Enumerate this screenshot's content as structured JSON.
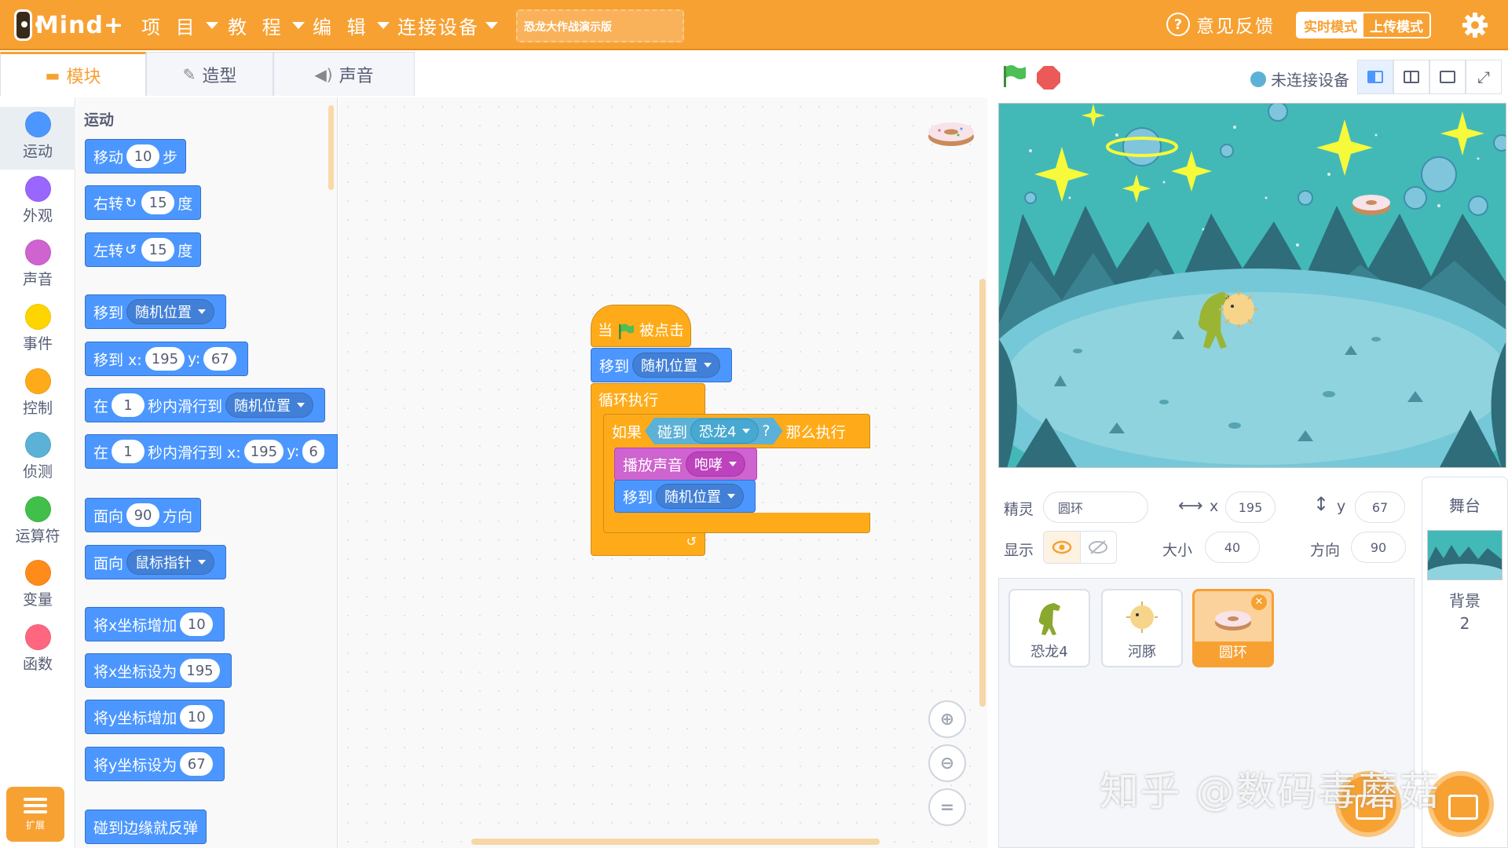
{
  "app": {
    "logo_text": "Mind+"
  },
  "menubar": {
    "items": [
      {
        "label": "项 目"
      },
      {
        "label": "教 程"
      },
      {
        "label": "编 辑"
      },
      {
        "label": "连接设备"
      }
    ],
    "project_name": "恐龙大作战演示版",
    "feedback": "意见反馈",
    "mode_realtime": "实时模式",
    "mode_upload": "上传模式",
    "colors": {
      "accent": "#f7a133"
    }
  },
  "tabs": [
    {
      "label": "模块",
      "icon": "blocks-icon"
    },
    {
      "label": "造型",
      "icon": "brush-icon"
    },
    {
      "label": "声音",
      "icon": "speaker-icon"
    }
  ],
  "categories": [
    {
      "label": "运动",
      "color": "#4c97ff"
    },
    {
      "label": "外观",
      "color": "#9966ff"
    },
    {
      "label": "声音",
      "color": "#cf63cf"
    },
    {
      "label": "事件",
      "color": "#ffd500"
    },
    {
      "label": "控制",
      "color": "#ffab19"
    },
    {
      "label": "侦测",
      "color": "#5cb1d6"
    },
    {
      "label": "运算符",
      "color": "#40bf4a"
    },
    {
      "label": "变量",
      "color": "#ff8c1a"
    },
    {
      "label": "函数",
      "color": "#ff6680"
    }
  ],
  "extend_label": "扩展",
  "palette": {
    "title": "运动",
    "blocks": {
      "move": {
        "a": "移动",
        "n": "10",
        "b": "步"
      },
      "turn_right": {
        "a": "右转",
        "n": "15",
        "b": "度"
      },
      "turn_left": {
        "a": "左转",
        "n": "15",
        "b": "度"
      },
      "goto": {
        "a": "移到",
        "dd": "随机位置"
      },
      "goto_xy": {
        "a": "移到 x:",
        "x": "195",
        "b": "y:",
        "y": "67"
      },
      "glide_to": {
        "a": "在",
        "n": "1",
        "b": "秒内滑行到",
        "dd": "随机位置"
      },
      "glide_xy": {
        "a": "在",
        "n": "1",
        "b": "秒内滑行到 x:",
        "x": "195",
        "c": "y:",
        "y": "6"
      },
      "point_dir": {
        "a": "面向",
        "n": "90",
        "b": "方向"
      },
      "point_towards": {
        "a": "面向",
        "dd": "鼠标指针"
      },
      "change_x": {
        "a": "将x坐标增加",
        "n": "10"
      },
      "set_x": {
        "a": "将x坐标设为",
        "n": "195"
      },
      "change_y": {
        "a": "将y坐标增加",
        "n": "10"
      },
      "set_y": {
        "a": "将y坐标设为",
        "n": "67"
      },
      "bounce": {
        "a": "碰到边缘就反弹"
      }
    }
  },
  "script": {
    "when_flag": {
      "a": "当",
      "b": "被点击"
    },
    "goto": {
      "a": "移到",
      "dd": "随机位置"
    },
    "forever": "循环执行",
    "if": {
      "a": "如果",
      "touch": "碰到",
      "target": "恐龙4",
      "q": "?",
      "then": "那么执行"
    },
    "play_sound": {
      "a": "播放声音",
      "dd": "咆哮"
    },
    "goto2": {
      "a": "移到",
      "dd": "随机位置"
    }
  },
  "stage_header": {
    "connection": "未连接设备"
  },
  "sprite_info": {
    "sprite_label": "精灵",
    "sprite_name": "圆环",
    "x_label": "x",
    "x": "195",
    "y_label": "y",
    "y": "67",
    "show_label": "显示",
    "size_label": "大小",
    "size": "40",
    "direction_label": "方向",
    "direction": "90"
  },
  "sprites": [
    {
      "name": "恐龙4"
    },
    {
      "name": "河豚"
    },
    {
      "name": "圆环",
      "selected": true
    }
  ],
  "stage_selector": {
    "title": "舞台",
    "backdrop_label": "背景",
    "backdrop_count": "2"
  },
  "watermark": "知乎 @数码毒蘑菇"
}
